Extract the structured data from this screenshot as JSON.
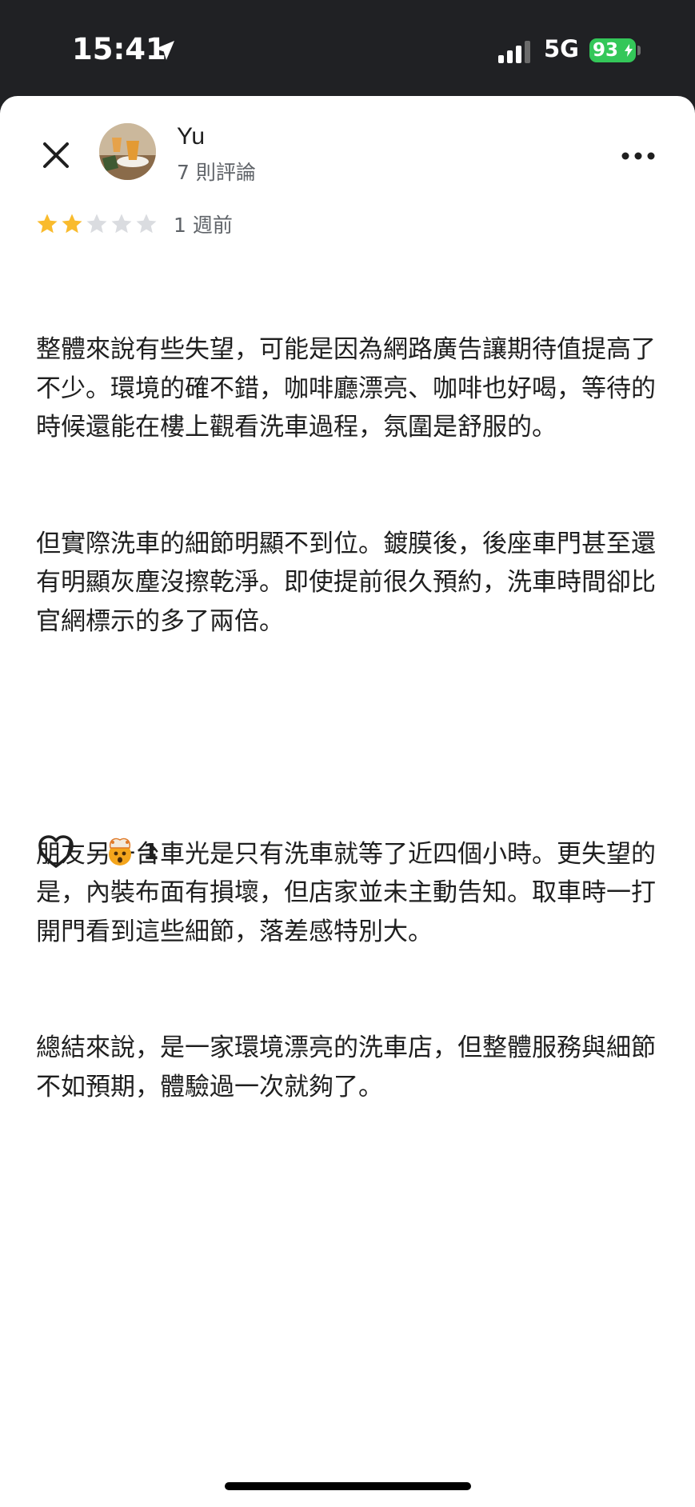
{
  "status_bar": {
    "time": "15:41",
    "network": "5G",
    "battery": "93"
  },
  "reviewer": {
    "name": "Yu",
    "review_count": "7 則評論"
  },
  "review": {
    "rating": 2,
    "max_rating": 5,
    "time_ago": "1 週前",
    "paragraphs": [
      "整體來說有些失望，可能是因為網路廣告讓期待值提高了不少。環境的確不錯，咖啡廳漂亮、咖啡也好喝，等待的時候還能在樓上觀看洗車過程，氛圍是舒服的。",
      "但實際洗車的細節明顯不到位。鍍膜後，後座車門甚至還有明顯灰塵沒擦乾淨。即使提前很久預約，洗車時間卻比官網標示的多了兩倍。",
      "",
      "朋友另一台車光是只有洗車就等了近四個小時。更失望的是，內裝布面有損壞，但店家並未主動告知。取車時一打開門看到這些細節，落差感特別大。",
      "總結來說，是一家環境漂亮的洗車店，但整體服務與細節不如預期，體驗過一次就夠了。"
    ]
  },
  "reactions": {
    "like_icon": "heart-outline-icon",
    "emoji_icon": "exploding-head-emoji",
    "emoji_count": "1"
  },
  "colors": {
    "star_filled": "#f9bb2d",
    "star_empty": "#dadce0",
    "battery": "#34c759"
  }
}
